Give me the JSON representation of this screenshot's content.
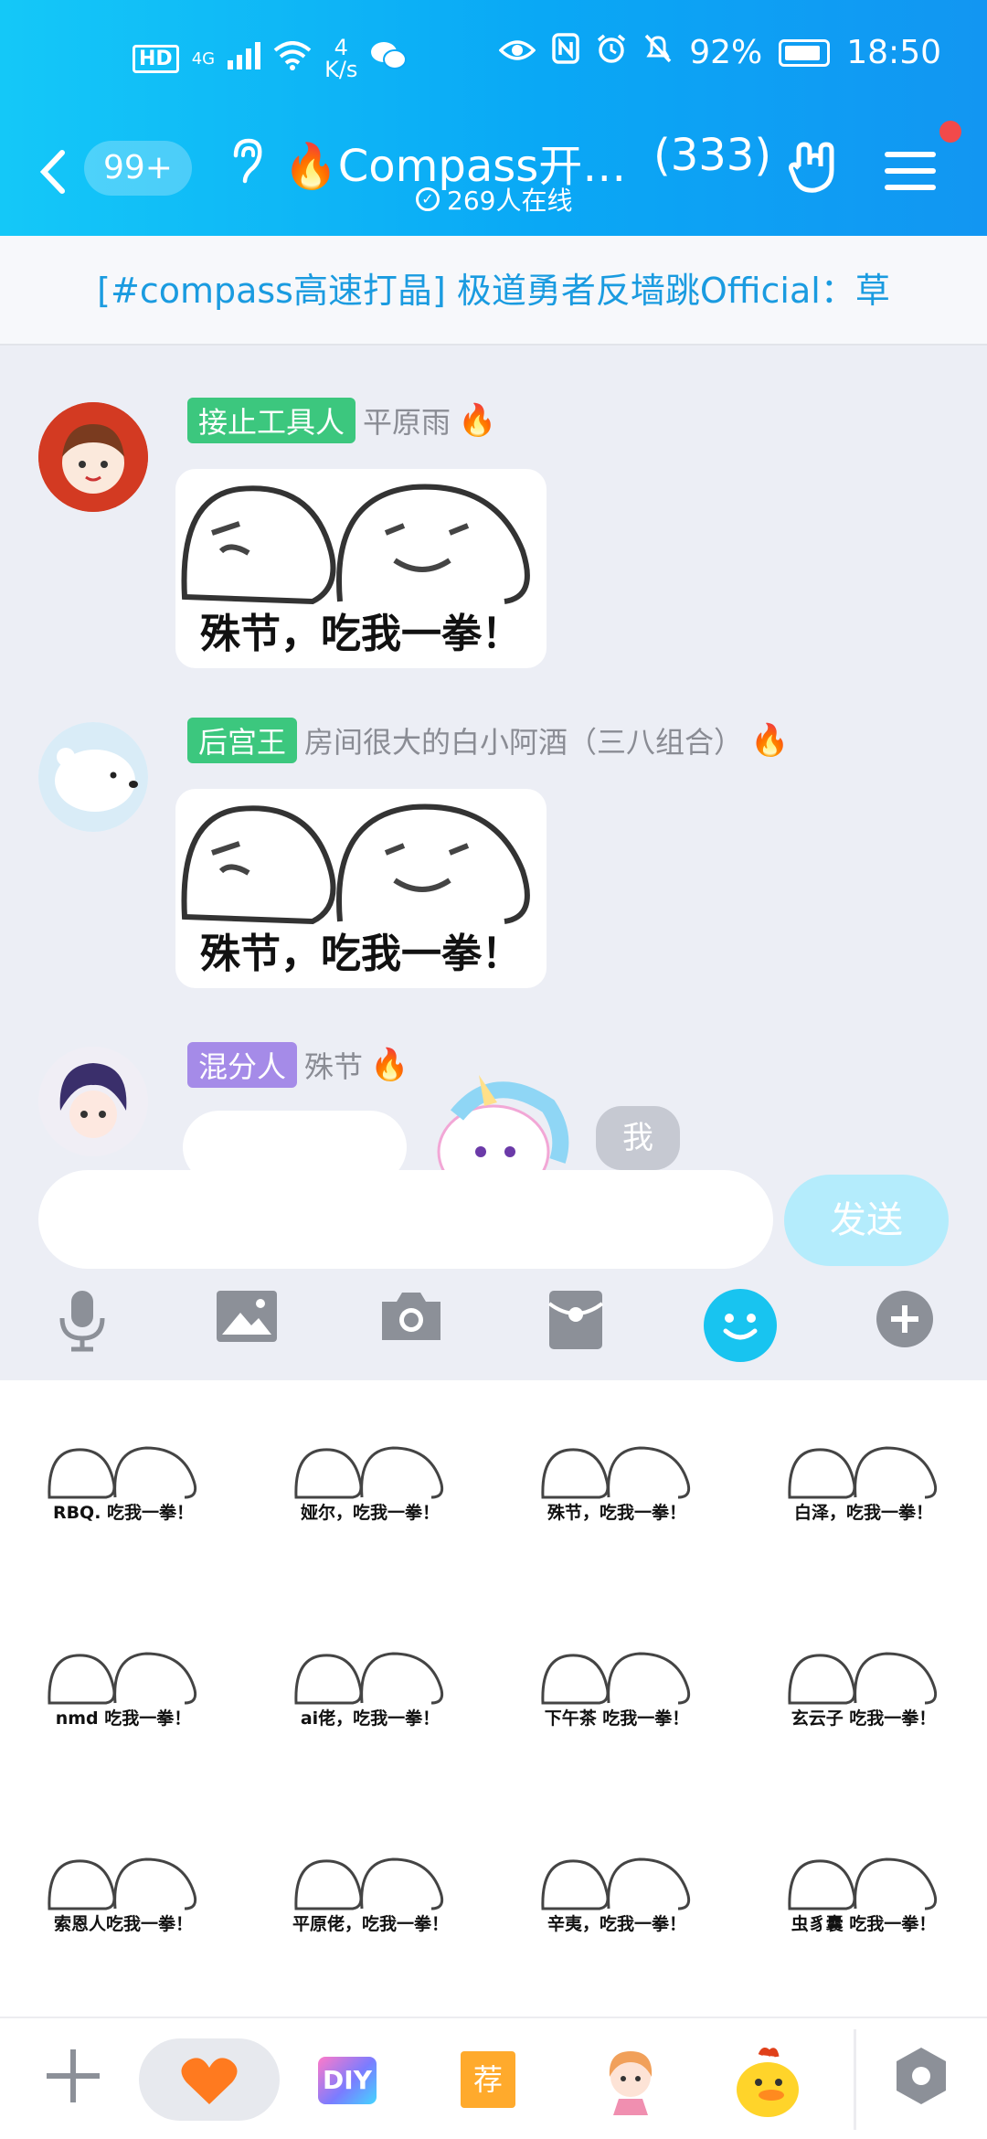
{
  "status_bar": {
    "hd": "HD",
    "signal": "4G",
    "net_speed_value": "4",
    "net_speed_unit": "K/s",
    "battery": "92%",
    "time": "18:50"
  },
  "header": {
    "unread": "99+",
    "title": "Compass开…",
    "member_count": "(333)",
    "online": "269人在线"
  },
  "notice": "[#compass高速打晶] 极道勇者反墙跳Official：草",
  "messages": [
    {
      "role": "接止工具人",
      "role_color": "#3cc77e",
      "sender": "平原雨",
      "sticker_text": "殊节，吃我一拳！"
    },
    {
      "role": "后宫王",
      "role_color": "#3cc77e",
      "sender": "房间很大的白小阿酒（三八组合）",
      "sticker_text": "殊节，吃我一拳！"
    },
    {
      "role": "混分人",
      "role_color": "#a58be8",
      "sender": "殊节",
      "partial_text": "我"
    }
  ],
  "input": {
    "send_label": "发送"
  },
  "toolbar": [
    "microphone-icon",
    "image-icon",
    "camera-icon",
    "red-packet-icon",
    "emoji-icon",
    "plus-icon"
  ],
  "sticker_panel": [
    "RBQ. 吃我一拳！",
    "娅尔，吃我一拳！",
    "殊节，吃我一拳！",
    "白泽，吃我一拳！",
    "nmd 吃我一拳！",
    "ai佬，吃我一拳！",
    "下午茶 吃我一拳！",
    "玄云子 吃我一拳！",
    "索恩人吃我一拳！",
    "平原佬，吃我一拳！",
    "辛夷，吃我一拳！",
    "虫豸囊 吃我一拳！"
  ],
  "bottom_tabs": {
    "diy": "DIY",
    "recommend": "荐"
  }
}
